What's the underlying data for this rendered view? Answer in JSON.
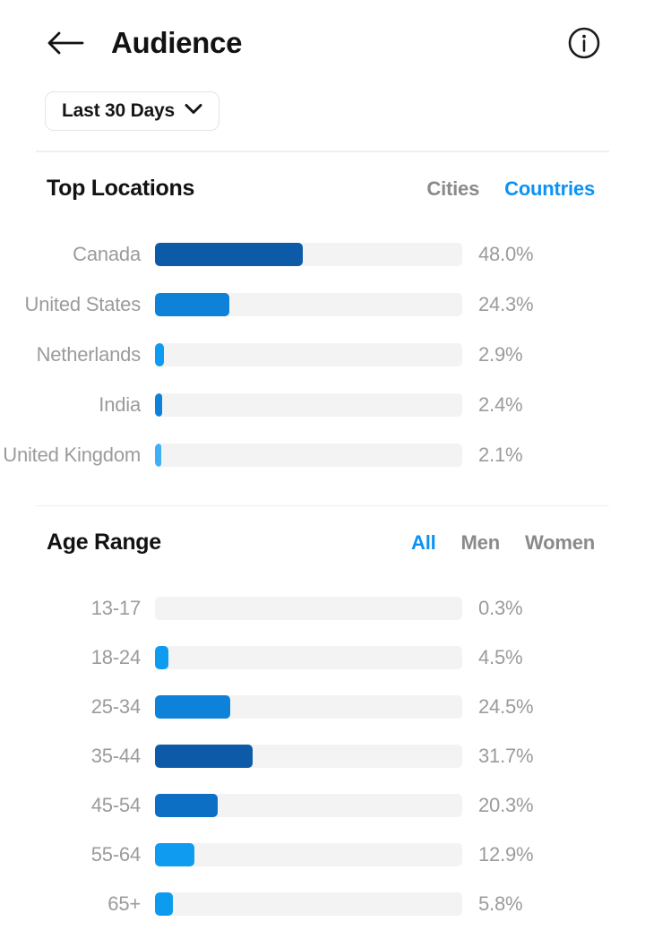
{
  "header": {
    "back_icon": "arrow-left-icon",
    "title": "Audience",
    "info_icon": "info-circle-icon"
  },
  "filter": {
    "label": "Last 30 Days",
    "chevron_icon": "chevron-down-icon"
  },
  "colors": {
    "accent_blue": "#0a93f5",
    "bar_darkest": "#0d5ba8",
    "bar_dark": "#0d6fc4",
    "bar_mid": "#0d82d8",
    "bar_light": "#0f9bf0",
    "bar_lighter": "#3fb0f5",
    "track": "#f3f3f3",
    "label_gray": "#9b9b9b",
    "title_black": "#121212"
  },
  "top_locations": {
    "title": "Top Locations",
    "tabs": [
      {
        "label": "Cities",
        "active": false
      },
      {
        "label": "Countries",
        "active": true
      }
    ]
  },
  "age_range": {
    "title": "Age Range",
    "tabs": [
      {
        "label": "All",
        "active": true
      },
      {
        "label": "Men",
        "active": false
      },
      {
        "label": "Women",
        "active": false
      }
    ]
  },
  "chart_data": [
    {
      "type": "bar",
      "title": "Top Locations",
      "orientation": "horizontal",
      "xlabel": "",
      "ylabel": "",
      "unit": "%",
      "xlim": [
        0,
        100
      ],
      "grid": false,
      "legend": false,
      "selected_tab": "Countries",
      "categories": [
        "Canada",
        "United States",
        "Netherlands",
        "India",
        "United Kingdom"
      ],
      "values": [
        48.0,
        24.3,
        2.9,
        2.4,
        2.1
      ],
      "value_labels": [
        "48.0%",
        "24.3%",
        "2.9%",
        "2.4%",
        "2.1%"
      ],
      "bar_colors": [
        "#0d5ba8",
        "#0d82d8",
        "#0f9bf0",
        "#0d82d8",
        "#3fb0f5"
      ]
    },
    {
      "type": "bar",
      "title": "Age Range",
      "orientation": "horizontal",
      "xlabel": "",
      "ylabel": "",
      "unit": "%",
      "xlim": [
        0,
        100
      ],
      "grid": false,
      "legend": false,
      "selected_tab": "All",
      "categories": [
        "13-17",
        "18-24",
        "25-34",
        "35-44",
        "45-54",
        "55-64",
        "65+"
      ],
      "values": [
        0.3,
        4.5,
        24.5,
        31.7,
        20.3,
        12.9,
        5.8
      ],
      "value_labels": [
        "0.3%",
        "4.5%",
        "24.5%",
        "31.7%",
        "20.3%",
        "12.9%",
        "5.8%"
      ],
      "bar_colors": [
        "#f3f3f3",
        "#0f9bf0",
        "#0d82d8",
        "#0d5ba8",
        "#0d6fc4",
        "#0f9bf0",
        "#0d9bf0"
      ]
    }
  ]
}
